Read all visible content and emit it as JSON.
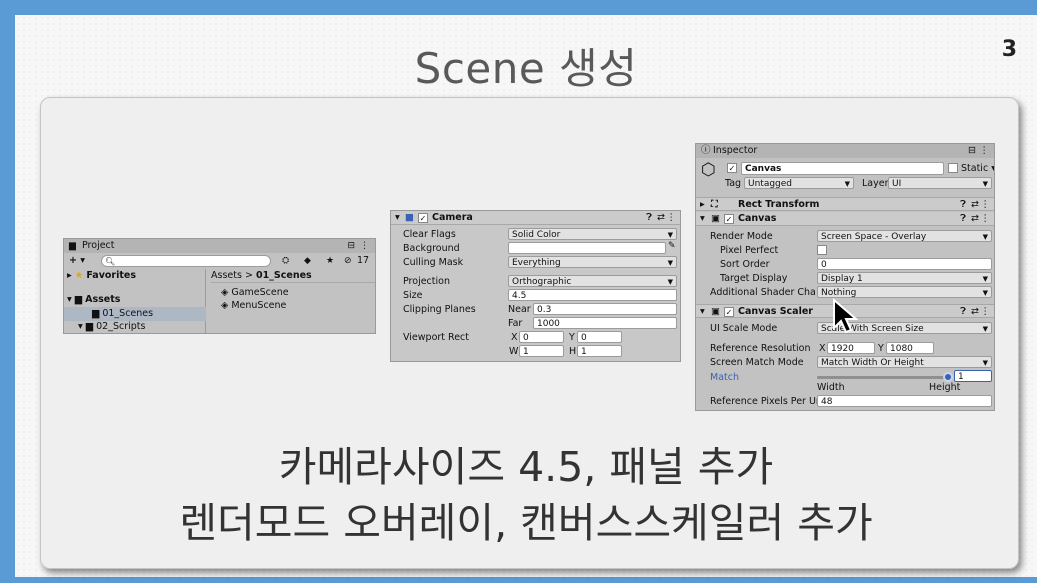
{
  "slide": {
    "title": "Scene 생성",
    "page_number": "3"
  },
  "project": {
    "tab": "Project",
    "badge_count": "17",
    "favorites": "Favorites",
    "assets": "Assets",
    "folders": [
      "01_Scenes",
      "02_Scripts"
    ],
    "breadcrumb_root": "Assets",
    "breadcrumb_sep": ">",
    "breadcrumb_current": "01_Scenes",
    "files": [
      "GameScene",
      "MenuScene"
    ]
  },
  "camera": {
    "title": "Camera",
    "clear_flags_label": "Clear Flags",
    "clear_flags": "Solid Color",
    "background_label": "Background",
    "culling_label": "Culling Mask",
    "culling": "Everything",
    "projection_label": "Projection",
    "projection": "Orthographic",
    "size_label": "Size",
    "size": "4.5",
    "clipping_label": "Clipping Planes",
    "near_label": "Near",
    "near": "0.3",
    "far_label": "Far",
    "far": "1000",
    "viewport_label": "Viewport Rect",
    "x_label": "X",
    "x": "0",
    "y_label": "Y",
    "y": "0",
    "w_label": "W",
    "w": "1",
    "h_label": "H",
    "h": "1"
  },
  "inspector": {
    "tab": "Inspector",
    "object_name": "Canvas",
    "static_label": "Static",
    "tag_label": "Tag",
    "tag": "Untagged",
    "layer_label": "Layer",
    "layer": "UI",
    "rect_transform": "Rect Transform",
    "canvas": {
      "title": "Canvas",
      "render_mode_label": "Render Mode",
      "render_mode": "Screen Space - Overlay",
      "pixel_perfect_label": "Pixel Perfect",
      "sort_order_label": "Sort Order",
      "sort_order": "0",
      "target_display_label": "Target Display",
      "target_display": "Display 1",
      "shader_channels_label": "Additional Shader Channels",
      "shader_channels": "Nothing"
    },
    "scaler": {
      "title": "Canvas Scaler",
      "ui_scale_label": "UI Scale Mode",
      "ui_scale": "Scale With Screen Size",
      "ref_res_label": "Reference Resolution",
      "ref_x_label": "X",
      "ref_x": "1920",
      "ref_y_label": "Y",
      "ref_y": "1080",
      "match_mode_label": "Screen Match Mode",
      "match_mode": "Match Width Or Height",
      "match_label": "Match",
      "match_value": "1",
      "match_fraction": 1.0,
      "width_label": "Width",
      "height_label": "Height",
      "ppu_label": "Reference Pixels Per Unit",
      "ppu": "48"
    }
  },
  "captions": {
    "line1": "카메라사이즈 4.5, 패널 추가",
    "line2": "렌더모드 오버레이, 캔버스스케일러 추가"
  },
  "colors": {
    "accent": "#5b9bd5",
    "unity_panel": "#c2c2c2",
    "link_blue": "#3a62b0"
  }
}
